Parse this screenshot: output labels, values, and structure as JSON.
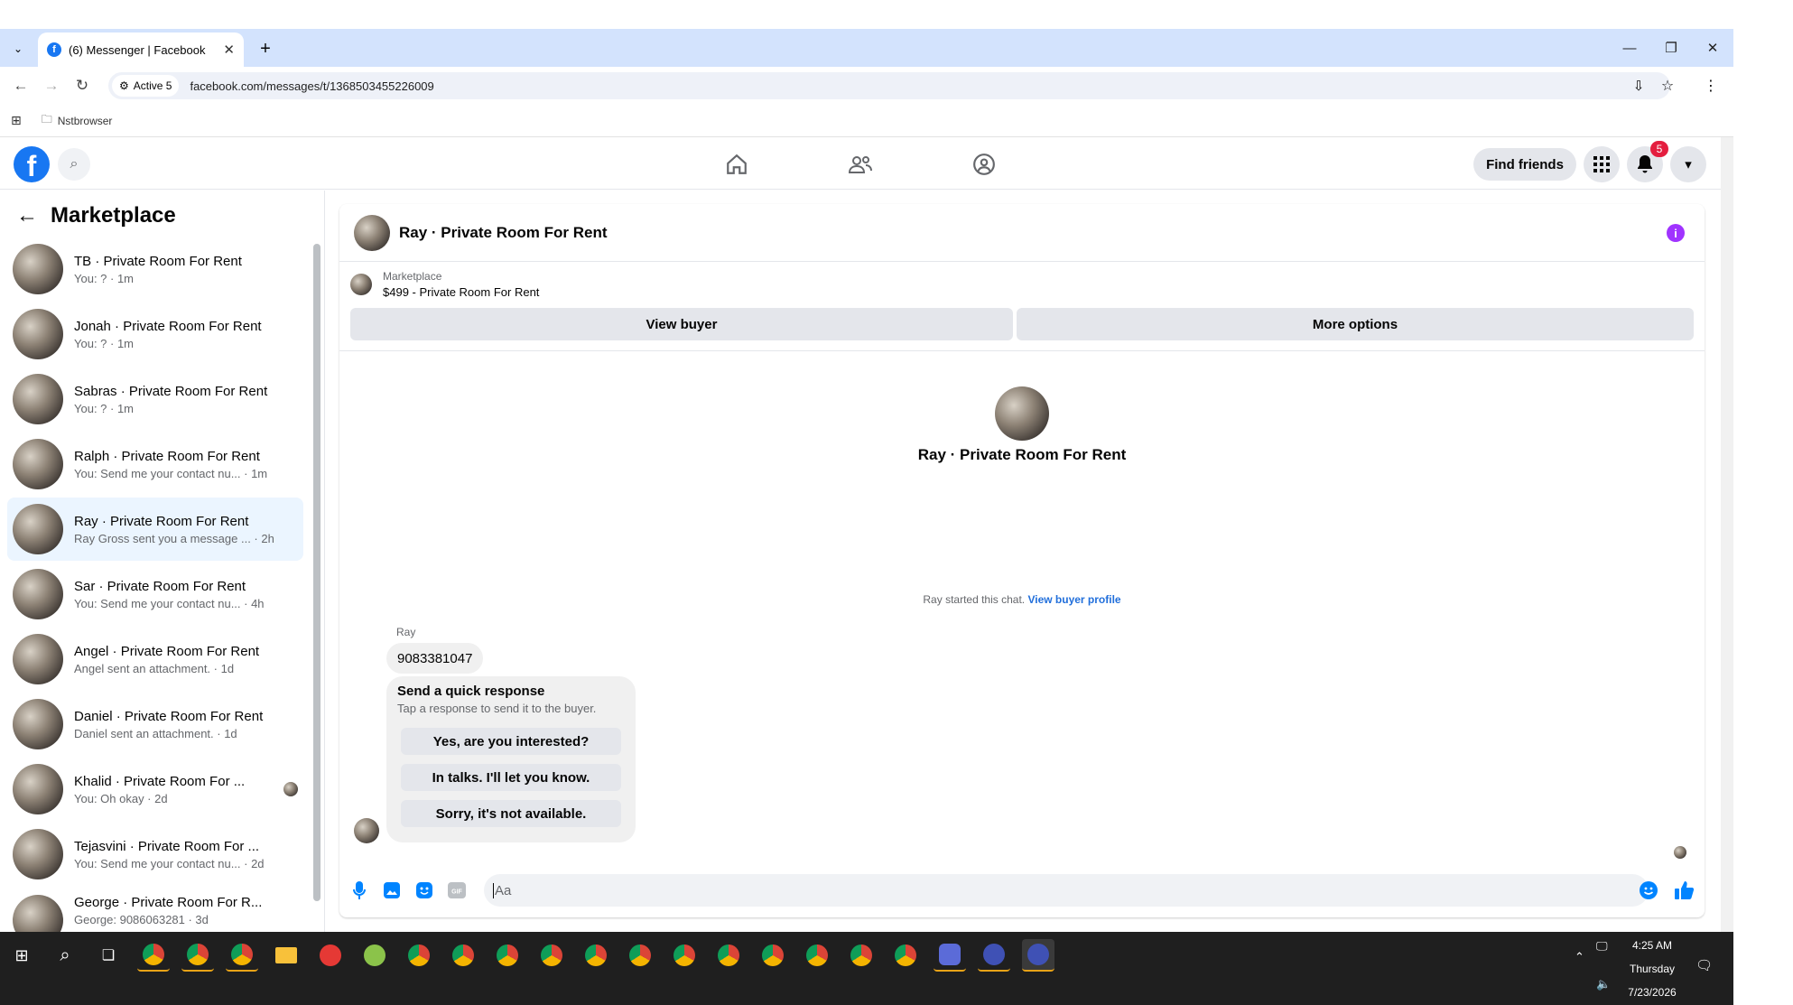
{
  "browser": {
    "tab_title": "(6) Messenger | Facebook",
    "site_chip": "Active 5",
    "url": "facebook.com/messages/t/1368503455226009",
    "bookmark_folder": "Nstbrowser"
  },
  "fb_nav": {
    "find_friends": "Find friends",
    "notif_count": "5"
  },
  "sidebar": {
    "title": "Marketplace",
    "conversations": [
      {
        "name": "TB · Private Room For Rent",
        "preview": "You: ? · 1m"
      },
      {
        "name": "Jonah · Private Room For Rent",
        "preview": "You: ? · 1m"
      },
      {
        "name": "Sabras · Private Room For Rent",
        "preview": "You: ? · 1m"
      },
      {
        "name": "Ralph · Private Room For Rent",
        "preview": "You: Send me your contact nu... · 1m"
      },
      {
        "name": "Ray · Private Room For Rent",
        "preview": "Ray Gross sent you a message ... · 2h"
      },
      {
        "name": "Sar · Private Room For Rent",
        "preview": "You: Send me your contact nu... · 4h"
      },
      {
        "name": "Angel · Private Room For Rent",
        "preview": "Angel sent an attachment. · 1d"
      },
      {
        "name": "Daniel · Private Room For Rent",
        "preview": "Daniel sent an attachment. · 1d"
      },
      {
        "name": "Khalid · Private Room For ...",
        "preview": "You: Oh okay · 2d"
      },
      {
        "name": "Tejasvini · Private Room For ...",
        "preview": "You: Send me your contact nu... · 2d"
      },
      {
        "name": "George · Private Room For R...",
        "preview": "George: 9086063281 · 3d"
      }
    ]
  },
  "chat": {
    "header_title": "Ray · Private Room For Rent",
    "mp_label": "Marketplace",
    "mp_listing": "$499 - Private Room For Rent",
    "view_buyer": "View buyer",
    "more_options": "More options",
    "center_title": "Ray · Private Room For Rent",
    "started_text": "Ray started this chat.",
    "view_buyer_profile": "View buyer profile",
    "sender": "Ray",
    "message": "9083381047",
    "quick_title": "Send a quick response",
    "quick_sub": "Tap a response to send it to the buyer.",
    "quick_responses": [
      "Yes, are you interested?",
      "In talks. I'll let you know.",
      "Sorry, it's not available."
    ],
    "composer_placeholder": "Aa"
  },
  "taskbar": {
    "time": "4:25 AM",
    "day": "Thursday",
    "date": "7/23/2026"
  },
  "colors": {
    "fb_blue": "#1877f2",
    "link_blue": "#216fdb",
    "selected_bg": "#ebf5ff",
    "badge_red": "#e41e3f",
    "taskbar": "#1f1f1f"
  }
}
